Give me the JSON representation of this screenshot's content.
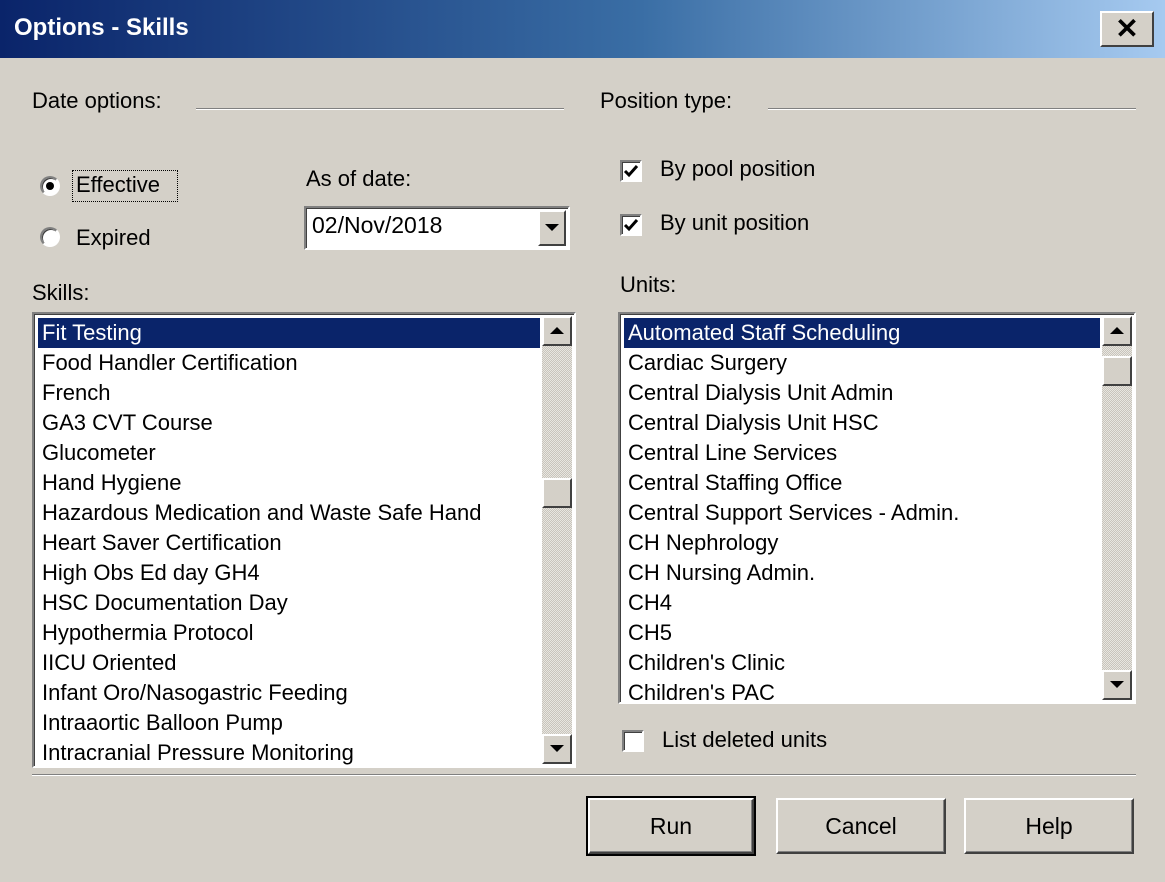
{
  "window": {
    "title": "Options - Skills",
    "close_label": "✕"
  },
  "date_options": {
    "group_label": "Date options:",
    "effective_label": "Effective",
    "expired_label": "Expired",
    "selected": "Effective",
    "as_of_label": "As of date:",
    "as_of_value": "02/Nov/2018"
  },
  "position_type": {
    "group_label": "Position type:",
    "by_pool_label": "By pool position",
    "by_pool_checked": true,
    "by_unit_label": "By unit position",
    "by_unit_checked": true
  },
  "skills": {
    "label": "Skills:",
    "items": [
      "Fit Testing",
      "Food Handler Certification",
      "French",
      "GA3 CVT Course",
      "Glucometer",
      "Hand Hygiene",
      "Hazardous Medication and Waste Safe Hand",
      "Heart Saver Certification",
      "High Obs Ed day GH4",
      "HSC Documentation Day",
      "Hypothermia Protocol",
      "IICU Oriented",
      "Infant Oro/Nasogastric Feeding",
      "Intraaortic Balloon Pump",
      "Intracranial Pressure Monitoring"
    ],
    "selected_index": 0
  },
  "units": {
    "label": "Units:",
    "items": [
      "Automated Staff Scheduling",
      "Cardiac Surgery",
      "Central Dialysis Unit Admin",
      "Central Dialysis Unit HSC",
      "Central Line Services",
      "Central Staffing Office",
      "Central Support Services - Admin.",
      "CH Nephrology",
      "CH Nursing Admin.",
      "CH4",
      "CH5",
      "Children's Clinic",
      "Children's PAC"
    ],
    "selected_index": 0,
    "list_deleted_label": "List deleted units",
    "list_deleted_checked": false
  },
  "buttons": {
    "run": "Run",
    "cancel": "Cancel",
    "help": "Help"
  }
}
